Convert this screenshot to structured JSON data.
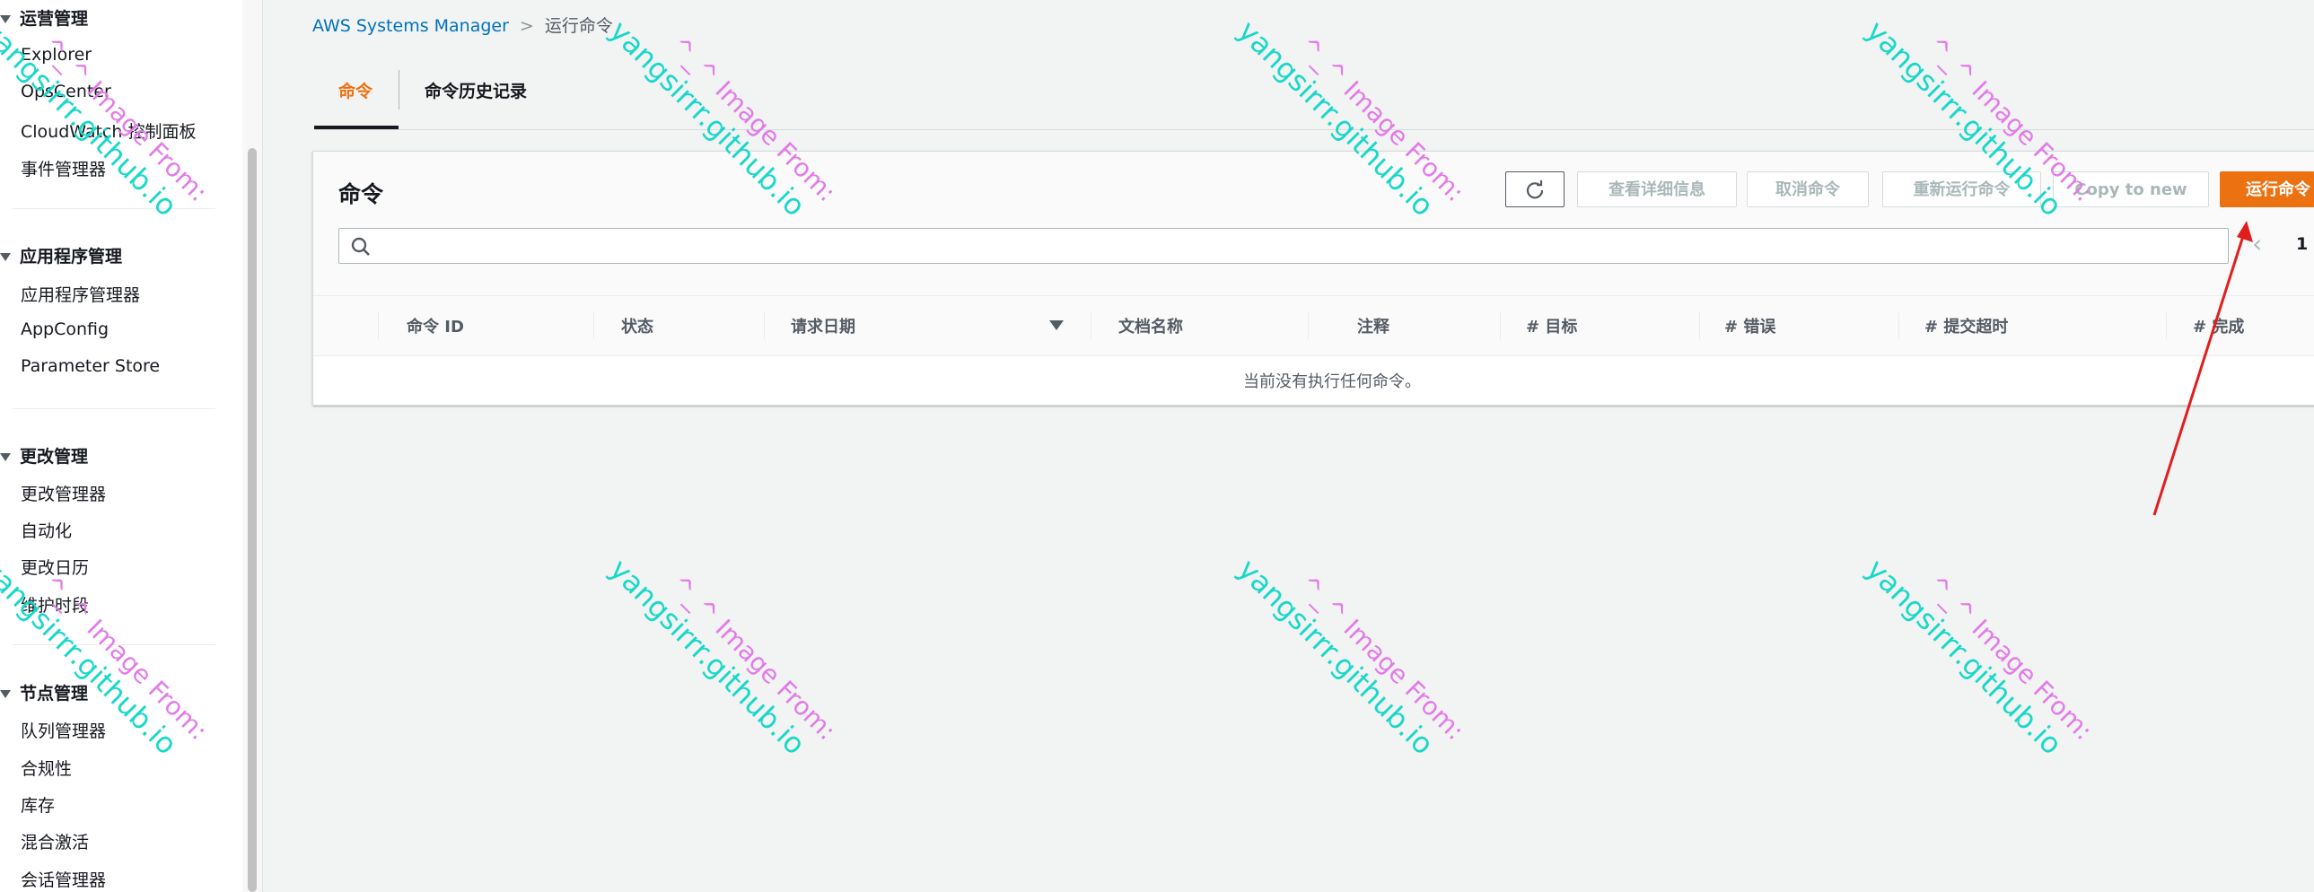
{
  "sidebar": {
    "groups": [
      {
        "title": "运营管理",
        "items": [
          "Explorer",
          "OpsCenter",
          "CloudWatch 控制面板",
          "事件管理器"
        ]
      },
      {
        "title": "应用程序管理",
        "items": [
          "应用程序管理器",
          "AppConfig",
          "Parameter Store"
        ]
      },
      {
        "title": "更改管理",
        "items": [
          "更改管理器",
          "自动化",
          "更改日历",
          "维护时段"
        ]
      },
      {
        "title": "节点管理",
        "items": [
          "队列管理器",
          "合规性",
          "库存",
          "混合激活",
          "会话管理器"
        ]
      }
    ]
  },
  "breadcrumb": {
    "root": "AWS Systems Manager",
    "current": "运行命令"
  },
  "tabs": [
    {
      "label": "命令",
      "active": true
    },
    {
      "label": "命令历史记录",
      "active": false
    }
  ],
  "panel": {
    "title": "命令",
    "buttons": {
      "view_details": "查看详细信息",
      "cancel": "取消命令",
      "rerun": "重新运行命令",
      "copy": "Copy to new",
      "run": "运行命令"
    },
    "search_placeholder": "",
    "page": "1",
    "columns": [
      "命令 ID",
      "状态",
      "请求日期",
      "文档名称",
      "注释",
      "# 目标",
      "# 错误",
      "# 提交超时",
      "# 完成"
    ],
    "empty_message": "当前没有执行任何命令。"
  },
  "watermark": {
    "line1": "^_^ Image From:",
    "line2": "yangsirrr.github.io"
  },
  "colors": {
    "accent": "#ec7211",
    "link": "#0073bb",
    "annotation_arrow": "#e01e1e"
  }
}
